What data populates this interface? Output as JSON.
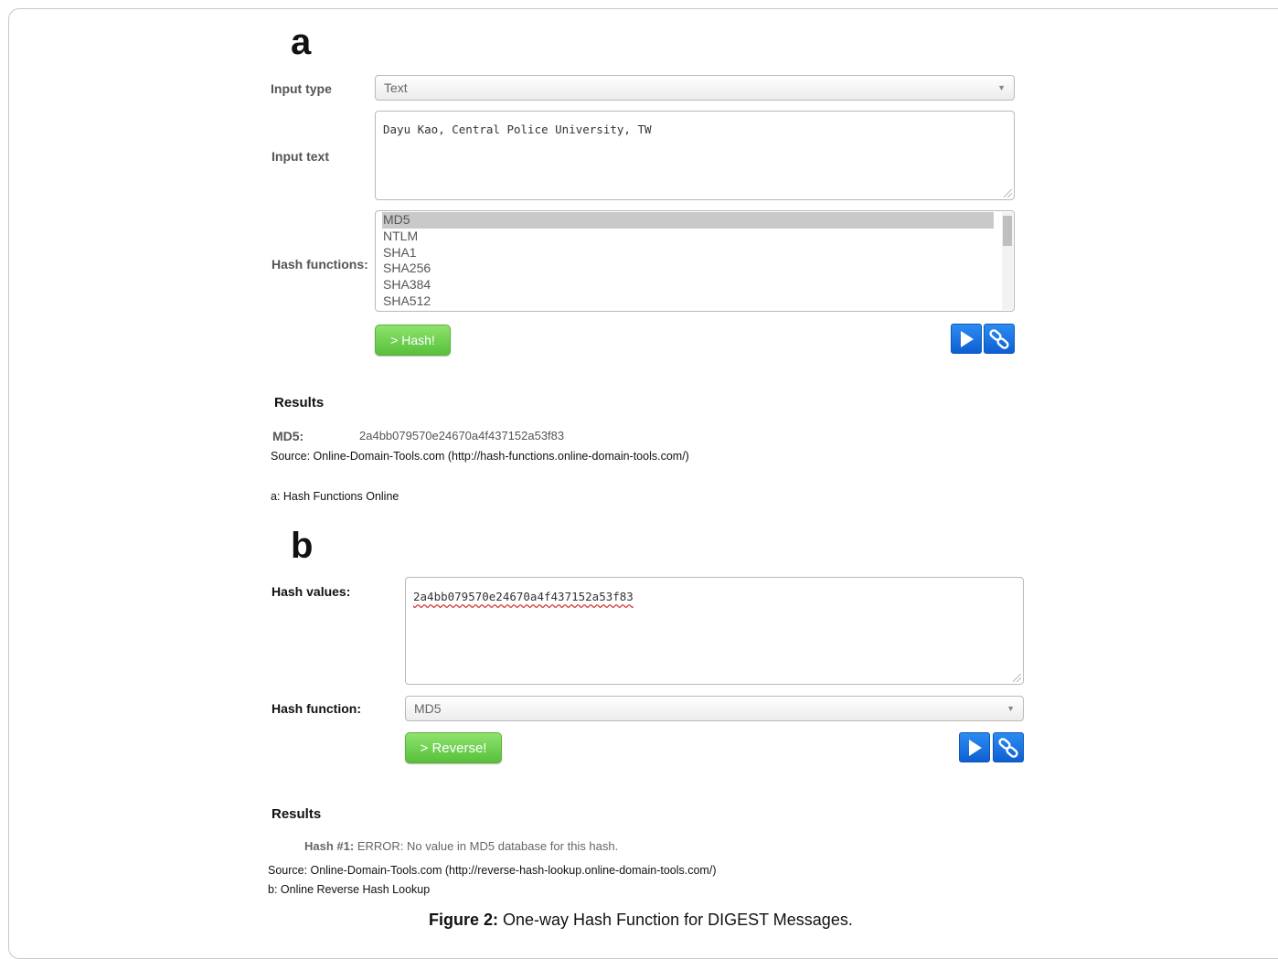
{
  "colors": {
    "hash_button": "#57c03b",
    "icon_button": "#1a6fe0",
    "selected_option": "#c9c9c9"
  },
  "panel_a": {
    "letter": "a",
    "input_type_label": "Input type",
    "input_type_value": "Text",
    "input_text_label": "Input text",
    "input_text_value": "Dayu Kao, Central Police University, TW",
    "hash_functions_label": "Hash functions:",
    "hash_functions_options": [
      "MD5",
      "NTLM",
      "SHA1",
      "SHA256",
      "SHA384",
      "SHA512"
    ],
    "hash_functions_selected": "MD5",
    "hash_button_label": "> Hash!",
    "results_heading": "Results",
    "result_label": "MD5:",
    "result_value": "2a4bb079570e24670a4f437152a53f83",
    "source": "Source: Online-Domain-Tools.com (http://hash-functions.online-domain-tools.com/)",
    "caption": "a: Hash Functions Online"
  },
  "panel_b": {
    "letter": "b",
    "hash_values_label": "Hash values:",
    "hash_values_value": "2a4bb079570e24670a4f437152a53f83",
    "hash_function_label": "Hash function:",
    "hash_function_value": "MD5",
    "reverse_button_label": "> Reverse!",
    "results_heading": "Results",
    "result_label": "Hash #1:",
    "result_value": "ERROR: No value in MD5 database for this hash.",
    "source": "Source: Online-Domain-Tools.com (http://reverse-hash-lookup.online-domain-tools.com/)",
    "caption": "b: Online Reverse Hash Lookup"
  },
  "figure": {
    "label": "Figure 2:",
    "text": " One-way Hash Function for DIGEST Messages."
  },
  "icons": {
    "play": "play-icon",
    "link": "link-icon"
  }
}
